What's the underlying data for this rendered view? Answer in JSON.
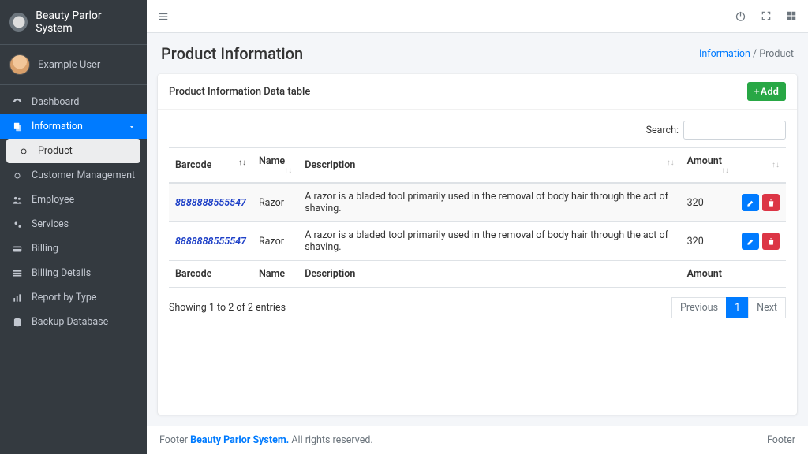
{
  "brand": "Beauty Parlor System",
  "user": {
    "name": "Example User"
  },
  "sidebar": {
    "items": [
      {
        "label": "Dashboard",
        "icon": "dashboard"
      },
      {
        "label": "Information",
        "icon": "copy",
        "open": true
      },
      {
        "label": "Product",
        "icon": "circle",
        "sub": true,
        "selected": true
      },
      {
        "label": "Customer Management",
        "icon": "circle"
      },
      {
        "label": "Employee",
        "icon": "users"
      },
      {
        "label": "Services",
        "icon": "cogs"
      },
      {
        "label": "Billing",
        "icon": "credit"
      },
      {
        "label": "Billing Details",
        "icon": "list"
      },
      {
        "label": "Report by Type",
        "icon": "chart"
      },
      {
        "label": "Backup Database",
        "icon": "db"
      }
    ]
  },
  "page": {
    "title": "Product Information",
    "breadcrumb": {
      "parent": "Information",
      "sep": "/",
      "current": "Product"
    }
  },
  "card": {
    "title": "Product Information Data table",
    "add_label": "Add"
  },
  "table": {
    "search_label": "Search:",
    "columns": [
      "Barcode",
      "Name",
      "Description",
      "Amount",
      ""
    ],
    "footer_columns": [
      "Barcode",
      "Name",
      "Description",
      "Amount",
      ""
    ],
    "rows": [
      {
        "barcode": "8888888555547",
        "name": "Razor",
        "desc": "A razor is a bladed tool primarily used in the removal of body hair through the act of shaving.",
        "amount": "320"
      },
      {
        "barcode": "8888888555547",
        "name": "Razor",
        "desc": "A razor is a bladed tool primarily used in the removal of body hair through the act of shaving.",
        "amount": "320"
      }
    ],
    "info": "Showing 1 to 2 of 2 entries",
    "pager": {
      "prev": "Previous",
      "pages": [
        "1"
      ],
      "next": "Next",
      "current": "1"
    }
  },
  "footer": {
    "left_a": "Footer ",
    "left_b": "Beauty Parlor System.",
    "left_c": " All rights reserved.",
    "right": "Footer"
  },
  "colors": {
    "accent": "#007bff",
    "success": "#28a745",
    "danger": "#dc3545",
    "sidebar": "#343a40"
  }
}
